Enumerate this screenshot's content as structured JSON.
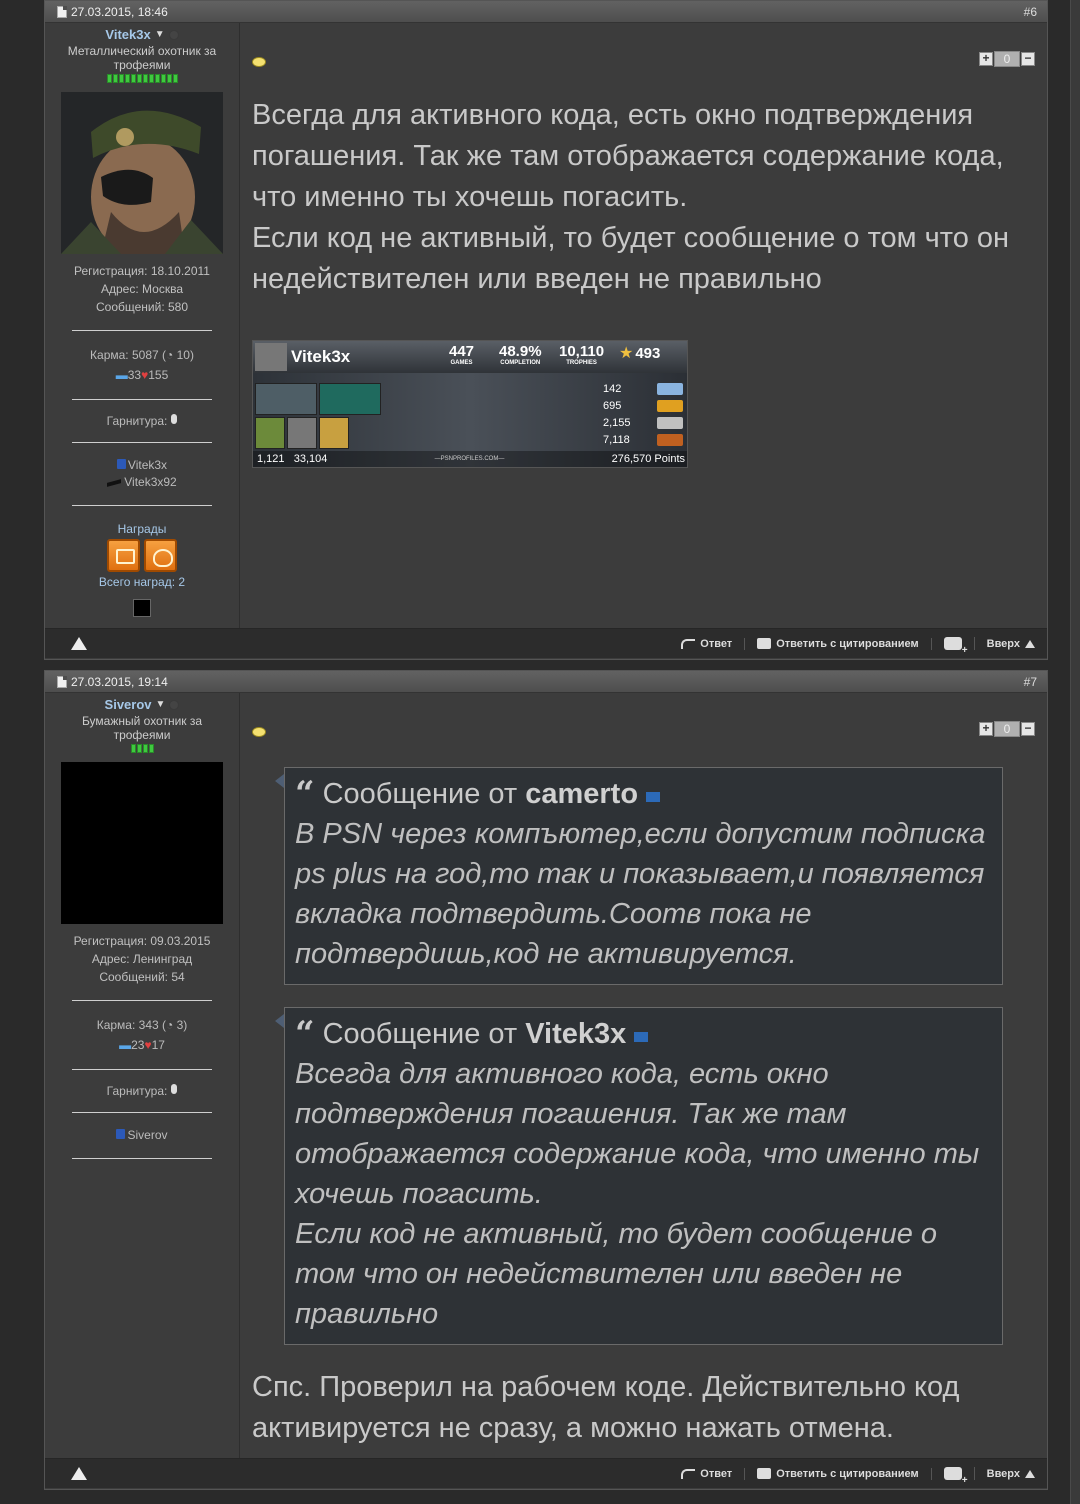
{
  "posts": [
    {
      "date": "27.03.2015, 18:46",
      "num": "#6",
      "user": {
        "name": "Vitek3x",
        "title": "Металлический охотник за трофеями",
        "stat_reg": "Регистрация: 18.10.2011",
        "stat_addr": "Адрес: Москва",
        "stat_msgs": "Сообщений: 580",
        "karma": "Карма: 5087 (",
        "karma_count": "10)",
        "karma_plus": "33",
        "karma_minus": "155",
        "headset": "Гарнитура:",
        "psn_id": "Vitek3x",
        "xbl_id": "Vitek3x92",
        "awards_title": "Награды",
        "awards_total": "Всего наград: 2"
      },
      "vote": {
        "plus": "+",
        "value": "0",
        "minus": "−"
      },
      "message": [
        "Всегда для активного кода, есть окно подтверждения погашения. Так же там отображается содержание кода, что именно ты хочешь погасить.",
        "Если код не активный, то будет сообщение о том что он недействителен или введен не правильно"
      ],
      "psn_card": {
        "name": "Vitek3x",
        "games": "447",
        "games_label": "GAMES",
        "completion": "48.9%",
        "completion_label": "COMPLETION",
        "trophies": "10,110",
        "trophies_label": "TROPHIES",
        "level": "493",
        "plat": "142",
        "gold": "695",
        "silver": "2,155",
        "bronze": "7,118",
        "rank_country": "1,121",
        "rank_world": "33,104",
        "site": "—PSNPROFILES.COM—",
        "points": "276,570 Points"
      }
    },
    {
      "date": "27.03.2015, 19:14",
      "num": "#7",
      "user": {
        "name": "Siverov",
        "title": "Бумажный охотник за трофеями",
        "stat_reg": "Регистрация: 09.03.2015",
        "stat_addr": "Адрес: Ленинград",
        "stat_msgs": "Сообщений: 54",
        "karma": "Карма: 343 (",
        "karma_count": "3)",
        "karma_plus": "23",
        "karma_minus": "17",
        "headset": "Гарнитура:",
        "psn_id": "Siverov"
      },
      "vote": {
        "plus": "+",
        "value": "0",
        "minus": "−"
      },
      "quotes": [
        {
          "prefix": "Сообщение от",
          "author": "camerto",
          "text": "В PSN через компъютер,если допустим подписка ps plus на год,то так и показывает,и появляется вкладка подтвердить.Соотв пока не подтвердишь,код не активируется."
        },
        {
          "prefix": "Сообщение от",
          "author": "Vitek3x",
          "text1": "Всегда для активного кода, есть окно подтверждения погашения. Так же там отображается содержание кода, что именно ты хочешь погасить.",
          "text2": "Если код не активный, то будет сообщение о том что он недействителен или введен не правильно"
        }
      ],
      "message": "Спс. Проверил на рабочем коде. Действительно код активируется не сразу, а можно нажать отмена."
    }
  ],
  "footer": {
    "reply": "Ответ",
    "reply_quote": "Ответить с цитированием",
    "top": "Вверх"
  },
  "icons": [
    "document-icon",
    "bubble-icon",
    "warning-icon",
    "reply-icon",
    "quote-icon",
    "multiquote-icon",
    "arrow-up-icon",
    "mic-icon",
    "psn-icon",
    "xbox-icon"
  ]
}
